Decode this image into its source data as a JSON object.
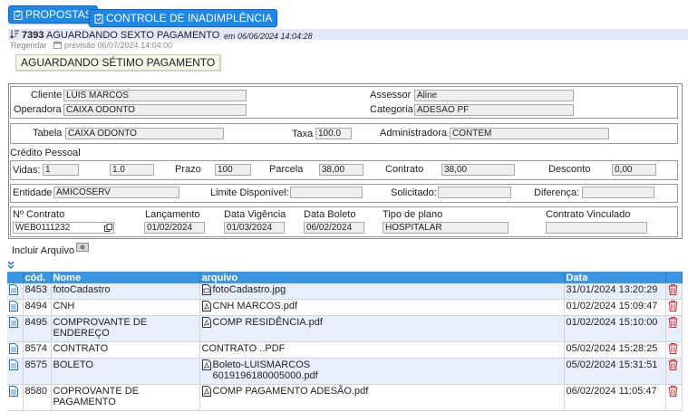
{
  "tabs": [
    {
      "label": "PROPOSTAS"
    },
    {
      "label": "CONTROLE DE INADIMPLÊNCIA"
    }
  ],
  "status": {
    "id": "7393",
    "text": "AGUARDANDO SEXTO PAGAMENTO",
    "date": "em 06/06/2024 14:04:28",
    "reschedule_label": "Regendar",
    "forecast": "previsão 06/07/2024 14:04:00",
    "next_label": "AGUARDANDO SÉTIMO PAGAMENTO"
  },
  "client": {
    "cliente_label": "Cliente",
    "cliente_value": "LUIS MARCOS",
    "operadora_label": "Operadora",
    "operadora_value": "CAIXA ODONTO",
    "assessor_label": "Assessor",
    "assessor_value": "Aline",
    "categoria_label": "Categoria",
    "categoria_value": "ADESÃO PF"
  },
  "plan": {
    "tabela_label": "Tabela",
    "tabela_value": "CAIXA ODONTO",
    "taxa_label": "Taxa",
    "taxa_value": "100.0",
    "admin_label": "Administradora",
    "admin_value": "CONTÈM"
  },
  "credit": {
    "section_label": "Crédito Pessoal",
    "vidas_label": "Vidas:",
    "vidas_value": "1",
    "factor_value": "1.0",
    "prazo_label": "Prazo",
    "prazo_value": "100",
    "parcela_label": "Parcela",
    "parcela_value": "38,00",
    "contrato_label": "Contrato",
    "contrato_value": "38,00",
    "desconto_label": "Desconto",
    "desconto_value": "0,00"
  },
  "entity": {
    "entidade_label": "Entidade",
    "entidade_value": "AMICOSERV",
    "limite_label": "Limite Disponível:",
    "limite_value": "",
    "solicitado_label": "Solicitado:",
    "solicitado_value": "",
    "diferenca_label": "Diferença:",
    "diferenca_value": ""
  },
  "contract": {
    "numero_label": "Nº Contrato",
    "numero_value": "WEB0111232",
    "lancamento_label": "Lançamento",
    "lancamento_value": "01/02/2024",
    "vigencia_label": "Data Vigência",
    "vigencia_value": "01/03/2024",
    "boleto_label": "Data Boleto",
    "boleto_value": "06/02/2024",
    "tipo_label": "Tipo de plano",
    "tipo_value": "HOSPITALAR",
    "vinculado_label": "Contrato Vinculado",
    "vinculado_value": ""
  },
  "attach": {
    "label": "Incluir Arquivo"
  },
  "files": {
    "headers": {
      "cod": "cód.",
      "nome": "Nome",
      "arquivo": "arquivo",
      "data": "Data"
    },
    "rows": [
      {
        "cod": "8453",
        "nome": "fotoCadastro",
        "arquivo": "fotoCadastro.jpg",
        "file_icon": "image-file-icon",
        "data": "31/01/2024 13:20:29"
      },
      {
        "cod": "8494",
        "nome": "CNH",
        "arquivo": "CNH MARCOS.pdf",
        "file_icon": "pdf-file-icon",
        "data": "01/02/2024 15:09:47"
      },
      {
        "cod": "8495",
        "nome": "COMPROVANTE DE ENDEREÇO",
        "arquivo": "COMP RESIDÊNCIA.pdf",
        "file_icon": "pdf-file-icon",
        "data": "01/02/2024 15:10:00"
      },
      {
        "cod": "8574",
        "nome": "CONTRATO",
        "arquivo": "CONTRATO ..PDF",
        "file_icon": "",
        "data": "05/02/2024 15:28:25"
      },
      {
        "cod": "8575",
        "nome": "BOLETO",
        "arquivo": "Boleto-LUISMARCOS 6019196180005000.pdf",
        "file_icon": "pdf-file-icon",
        "data": "05/02/2024 15:31:51"
      },
      {
        "cod": "8580",
        "nome": "COPROVANTE DE PAGAMENTO",
        "arquivo": "COMP PAGAMENTO ADESÃO.pdf",
        "file_icon": "pdf-file-icon",
        "data": "06/02/2024 11:05:47"
      }
    ]
  },
  "colors": {
    "tab_bg": "#1e88e5",
    "table_header": "#3a96e5",
    "row_alt": "#e8eefa",
    "delete_red": "#c62828"
  }
}
